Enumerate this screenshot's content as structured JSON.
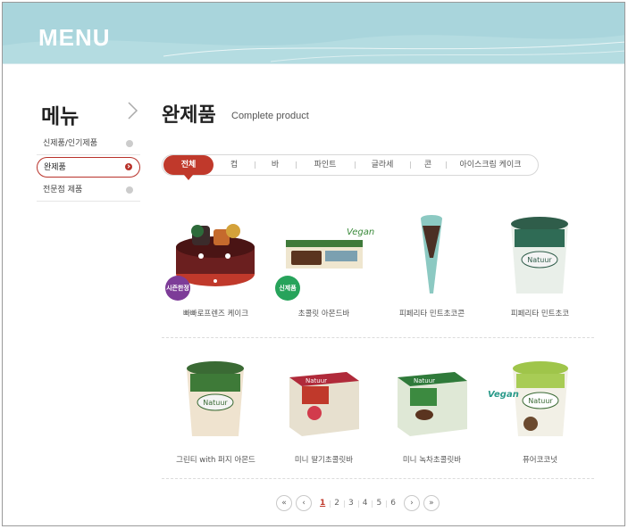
{
  "banner": {
    "title": "MENU"
  },
  "sidebar": {
    "title": "메뉴",
    "items": [
      {
        "label": "신제품/인기제품",
        "active": false
      },
      {
        "label": "완제품",
        "active": true
      },
      {
        "label": "전문점 제품",
        "active": false
      }
    ]
  },
  "main": {
    "title": "완제품",
    "subtitle": "Complete product",
    "tabs": [
      "전체",
      "컵",
      "바",
      "파인트",
      "글라세",
      "콘",
      "아이스크림 케이크"
    ],
    "active_tab": "전체",
    "products": [
      {
        "name": "빠빠로프렌즈 케이크",
        "badge": "시즌한정",
        "icon": "cake-product-icon"
      },
      {
        "name": "초콜릿 아몬드바",
        "badge": "신제품",
        "brand_mark": "Vegan",
        "icon": "bar-box-product-icon"
      },
      {
        "name": "피페리타 민트초코콘",
        "icon": "cone-product-icon"
      },
      {
        "name": "피페리타 민트초코",
        "brand": "Natuur",
        "icon": "pint-product-icon"
      },
      {
        "name": "그린티 with 퍼지 아몬드",
        "brand": "Natuur",
        "icon": "pint-product-icon"
      },
      {
        "name": "미니 딸기초콜릿바",
        "brand": "Natuur",
        "icon": "box-product-icon"
      },
      {
        "name": "미니 녹차초콜릿바",
        "brand": "Natuur",
        "icon": "box-product-icon"
      },
      {
        "name": "퓨어코코넛",
        "brand": "Natuur",
        "brand_mark": "Vegan",
        "icon": "pint-product-icon"
      }
    ]
  },
  "pagination": {
    "first": "«",
    "prev": "‹",
    "pages": [
      "1",
      "2",
      "3",
      "4",
      "5",
      "6"
    ],
    "current": "1",
    "next": "›",
    "last": "»"
  },
  "colors": {
    "accent": "#c0392b",
    "banner": "#a9d5dc"
  }
}
